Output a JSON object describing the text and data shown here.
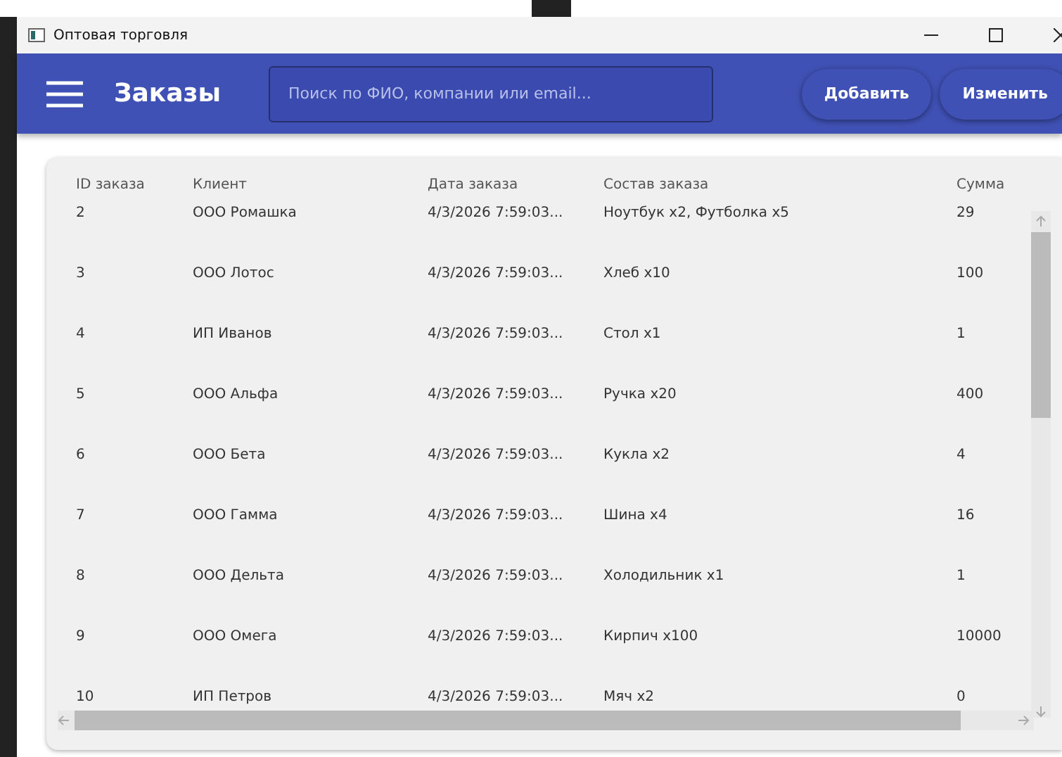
{
  "window": {
    "title": "Оптовая торговля"
  },
  "header": {
    "title": "Заказы",
    "search": {
      "placeholder": "Поиск по ФИО, компании или email..."
    },
    "buttons": [
      "Добавить",
      "Изменить"
    ]
  },
  "table": {
    "columns": [
      "ID заказа",
      "Клиент",
      "Дата заказа",
      "Состав заказа",
      "Сумма"
    ],
    "rows": [
      [
        "2",
        "ООО Ромашка",
        "4/3/2026 7:59:03...",
        "Ноутбук x2, Футболка x5",
        "29"
      ],
      [
        "3",
        "ООО Лотос",
        "4/3/2026 7:59:03...",
        "Хлеб x10",
        "100"
      ],
      [
        "4",
        "ИП Иванов",
        "4/3/2026 7:59:03...",
        "Стол x1",
        "1"
      ],
      [
        "5",
        "ООО Альфа",
        "4/3/2026 7:59:03...",
        "Ручка x20",
        "400"
      ],
      [
        "6",
        "ООО Бета",
        "4/3/2026 7:59:03...",
        "Кукла x2",
        "4"
      ],
      [
        "7",
        "ООО Гамма",
        "4/3/2026 7:59:03...",
        "Шина x4",
        "16"
      ],
      [
        "8",
        "ООО Дельта",
        "4/3/2026 7:59:03...",
        "Холодильник x1",
        "1"
      ],
      [
        "9",
        "ООО Омега",
        "4/3/2026 7:59:03...",
        "Кирпич x100",
        "10000"
      ],
      [
        "10",
        "ИП Петров",
        "4/3/2026 7:59:03...",
        "Мяч x2",
        "0"
      ]
    ]
  }
}
